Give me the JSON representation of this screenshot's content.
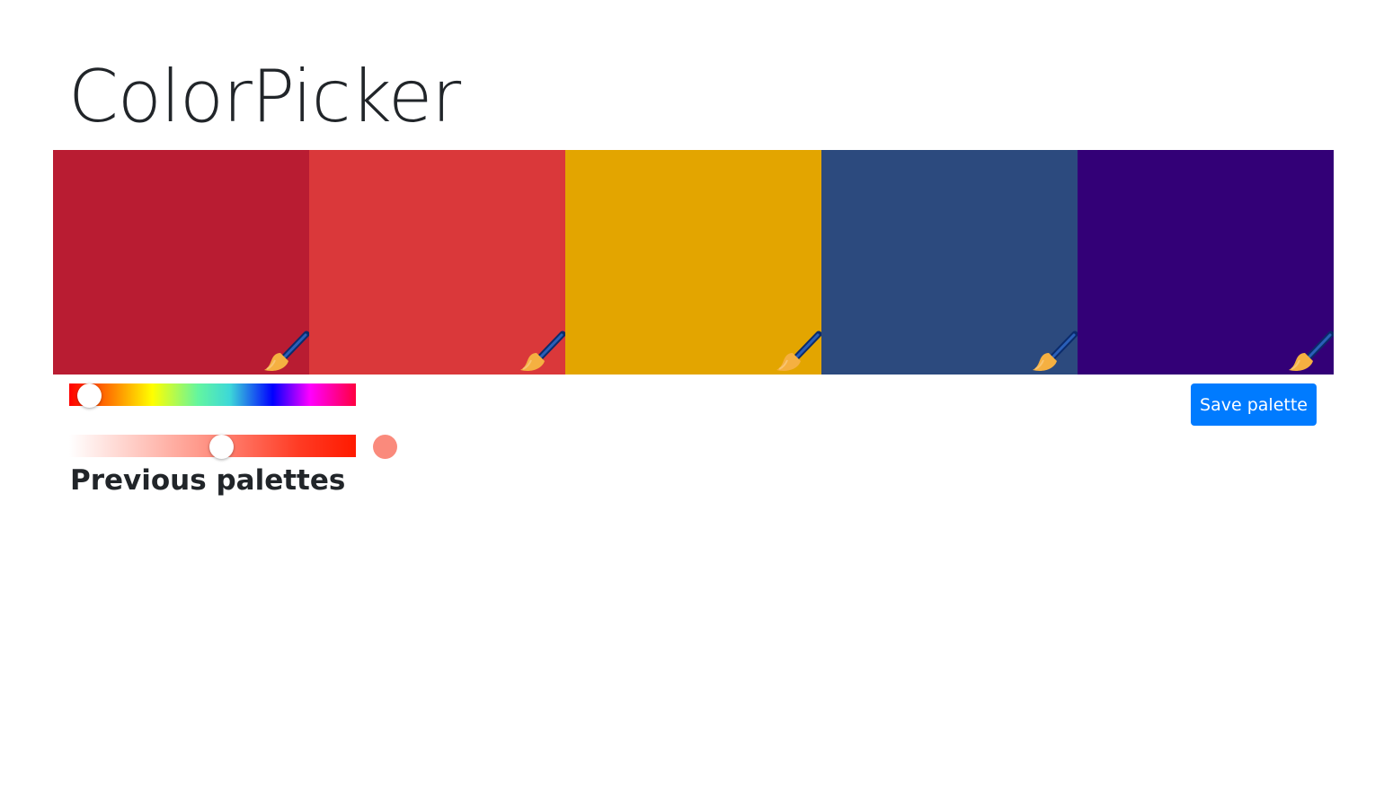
{
  "header": {
    "title": "ColorPicker"
  },
  "palette": {
    "swatches": [
      {
        "color": "#b91c32",
        "icon": "paintbrush-icon"
      },
      {
        "color": "#da383a",
        "icon": "paintbrush-icon"
      },
      {
        "color": "#e3a500",
        "icon": "paintbrush-icon"
      },
      {
        "color": "#2c4a7e",
        "icon": "paintbrush-icon"
      },
      {
        "color": "#330077",
        "icon": "paintbrush-icon"
      }
    ]
  },
  "controls": {
    "hue": {
      "value": 0.07
    },
    "saturation": {
      "value": 0.53
    },
    "preview_color": "#fa8a7c",
    "save_label": "Save palette",
    "save_color": "#007bff"
  },
  "previous": {
    "title": "Previous palettes"
  }
}
